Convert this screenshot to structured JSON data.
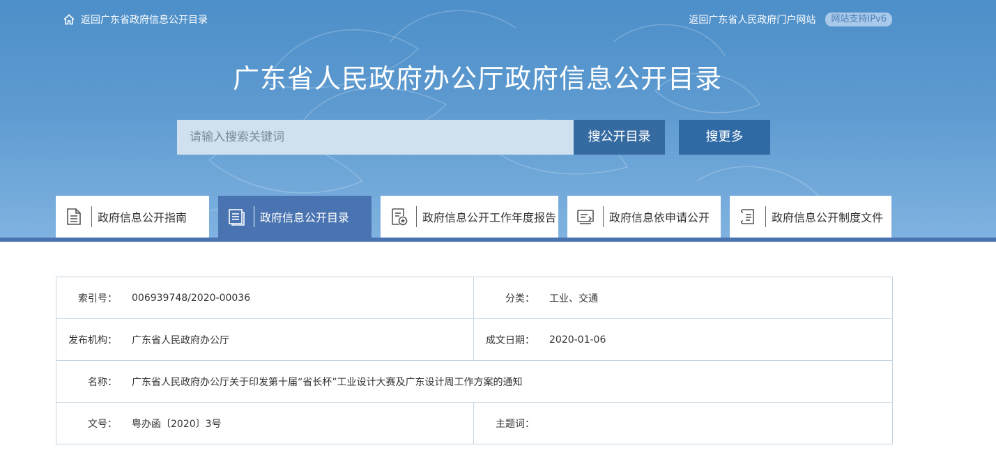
{
  "topbar": {
    "back_link": "返回广东省政府信息公开目录",
    "portal_link": "返回广东省人民政府门户网站",
    "ipv6_badge": "网站支持IPv6"
  },
  "header": {
    "title": "广东省人民政府办公厅政府信息公开目录"
  },
  "search": {
    "placeholder": "请输入搜索关键词",
    "value": "",
    "catalog_button": "搜公开目录",
    "more_button": "搜更多"
  },
  "tabs": [
    {
      "label": "政府信息公开指南",
      "icon": "document-lines-icon",
      "active": false
    },
    {
      "label": "政府信息公开目录",
      "icon": "catalog-icon",
      "active": true
    },
    {
      "label": "政府信息公开工作年度报告",
      "icon": "report-star-icon",
      "active": false
    },
    {
      "label": "政府信息依申请公开",
      "icon": "application-form-icon",
      "active": false
    },
    {
      "label": "政府信息公开制度文件",
      "icon": "policy-scroll-icon",
      "active": false
    }
  ],
  "info": {
    "index_label": "索引号：",
    "index_value": "006939748/2020-00036",
    "category_label": "分类：",
    "category_value": "工业、交通",
    "publisher_label": "发布机构：",
    "publisher_value": "广东省人民政府办公厅",
    "date_label": "成文日期：",
    "date_value": "2020-01-06",
    "name_label": "名称：",
    "name_value": "广东省人民政府办公厅关于印发第十届“省长杯”工业设计大赛及广东设计周工作方案的通知",
    "docno_label": "文号：",
    "docno_value": "粤办函〔2020〕3号",
    "subject_label": "主题词：",
    "subject_value": ""
  },
  "colors": {
    "banner_top": "#4d8fc9",
    "banner_bottom": "#7fb2e0",
    "accent": "#4a74b1",
    "button": "#366ba2",
    "table_border": "#c4d6e2"
  }
}
